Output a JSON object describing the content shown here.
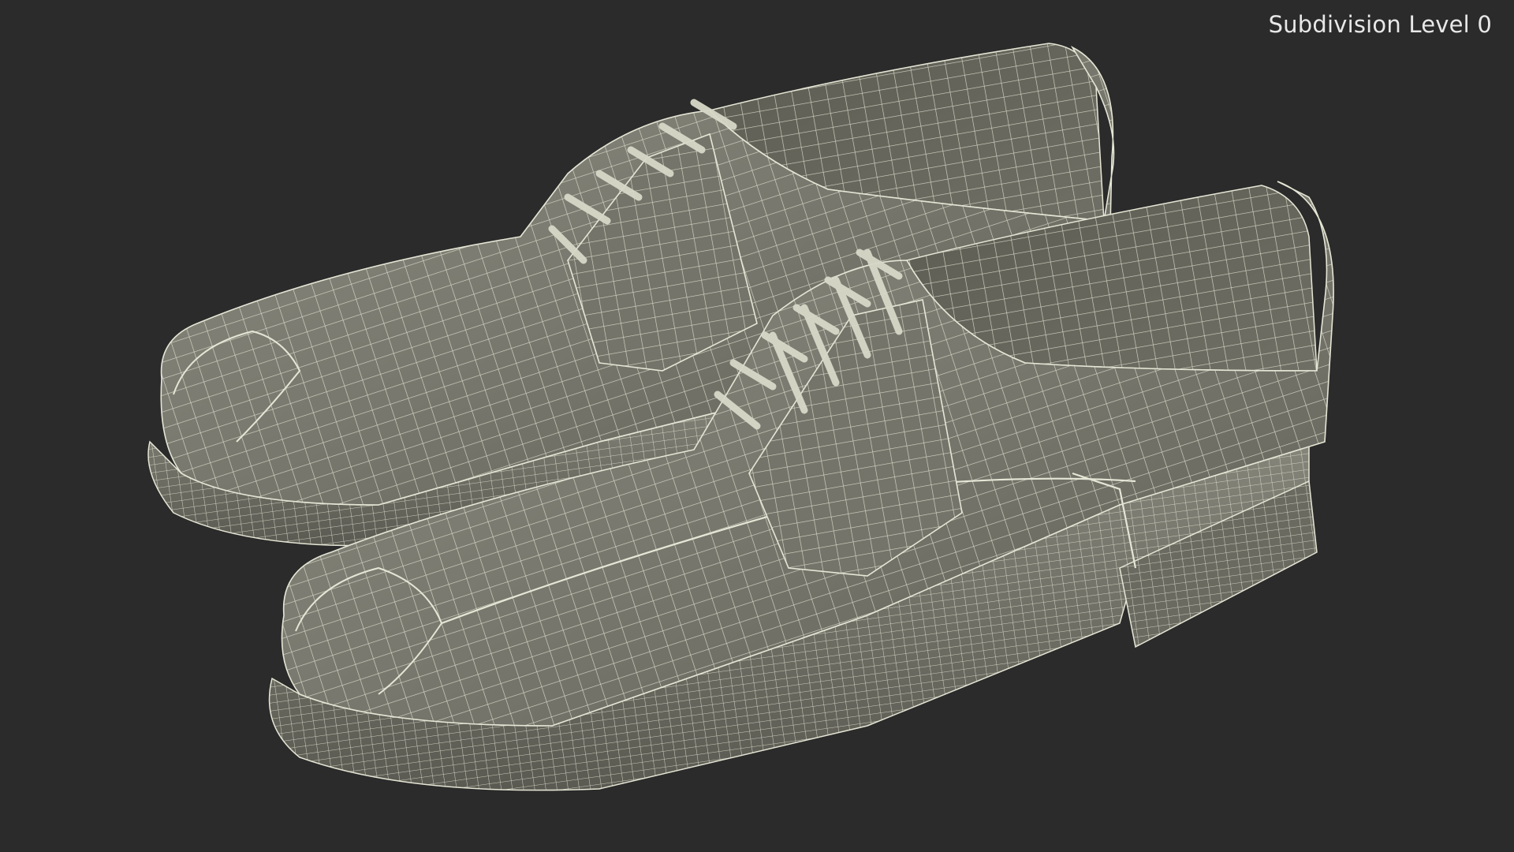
{
  "viewport": {
    "overlay_label": "Subdivision Level 0",
    "background_color": "#2b2b2b",
    "object_color": "#7c7c72",
    "wire_color": "#e6e6d6",
    "subject": "pair of lace-up derby shoes, wireframe mesh"
  }
}
